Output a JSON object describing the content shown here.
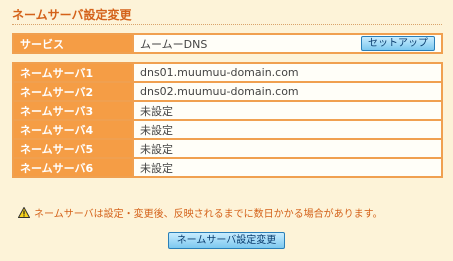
{
  "page": {
    "title": "ネームサーバ設定変更"
  },
  "service": {
    "label": "サービス",
    "value": "ムームーDNS",
    "setup_button": "セットアップ"
  },
  "nameservers": [
    {
      "label": "ネームサーバ1",
      "value": "dns01.muumuu-domain.com"
    },
    {
      "label": "ネームサーバ2",
      "value": "dns02.muumuu-domain.com"
    },
    {
      "label": "ネームサーバ3",
      "value": "未設定"
    },
    {
      "label": "ネームサーバ4",
      "value": "未設定"
    },
    {
      "label": "ネームサーバ5",
      "value": "未設定"
    },
    {
      "label": "ネームサーバ6",
      "value": "未設定"
    }
  ],
  "notice": {
    "icon": "warning-icon",
    "text": "ネームサーバは設定・変更後、反映されるまでに数日かかる場合があります。"
  },
  "submit_button": "ネームサーバ設定変更",
  "colors": {
    "background": "#fdf3d8",
    "label_bg": "#f59d45",
    "border": "#f0a050",
    "accent_text": "#d4621a",
    "button_blue": "#7cc8ef"
  }
}
